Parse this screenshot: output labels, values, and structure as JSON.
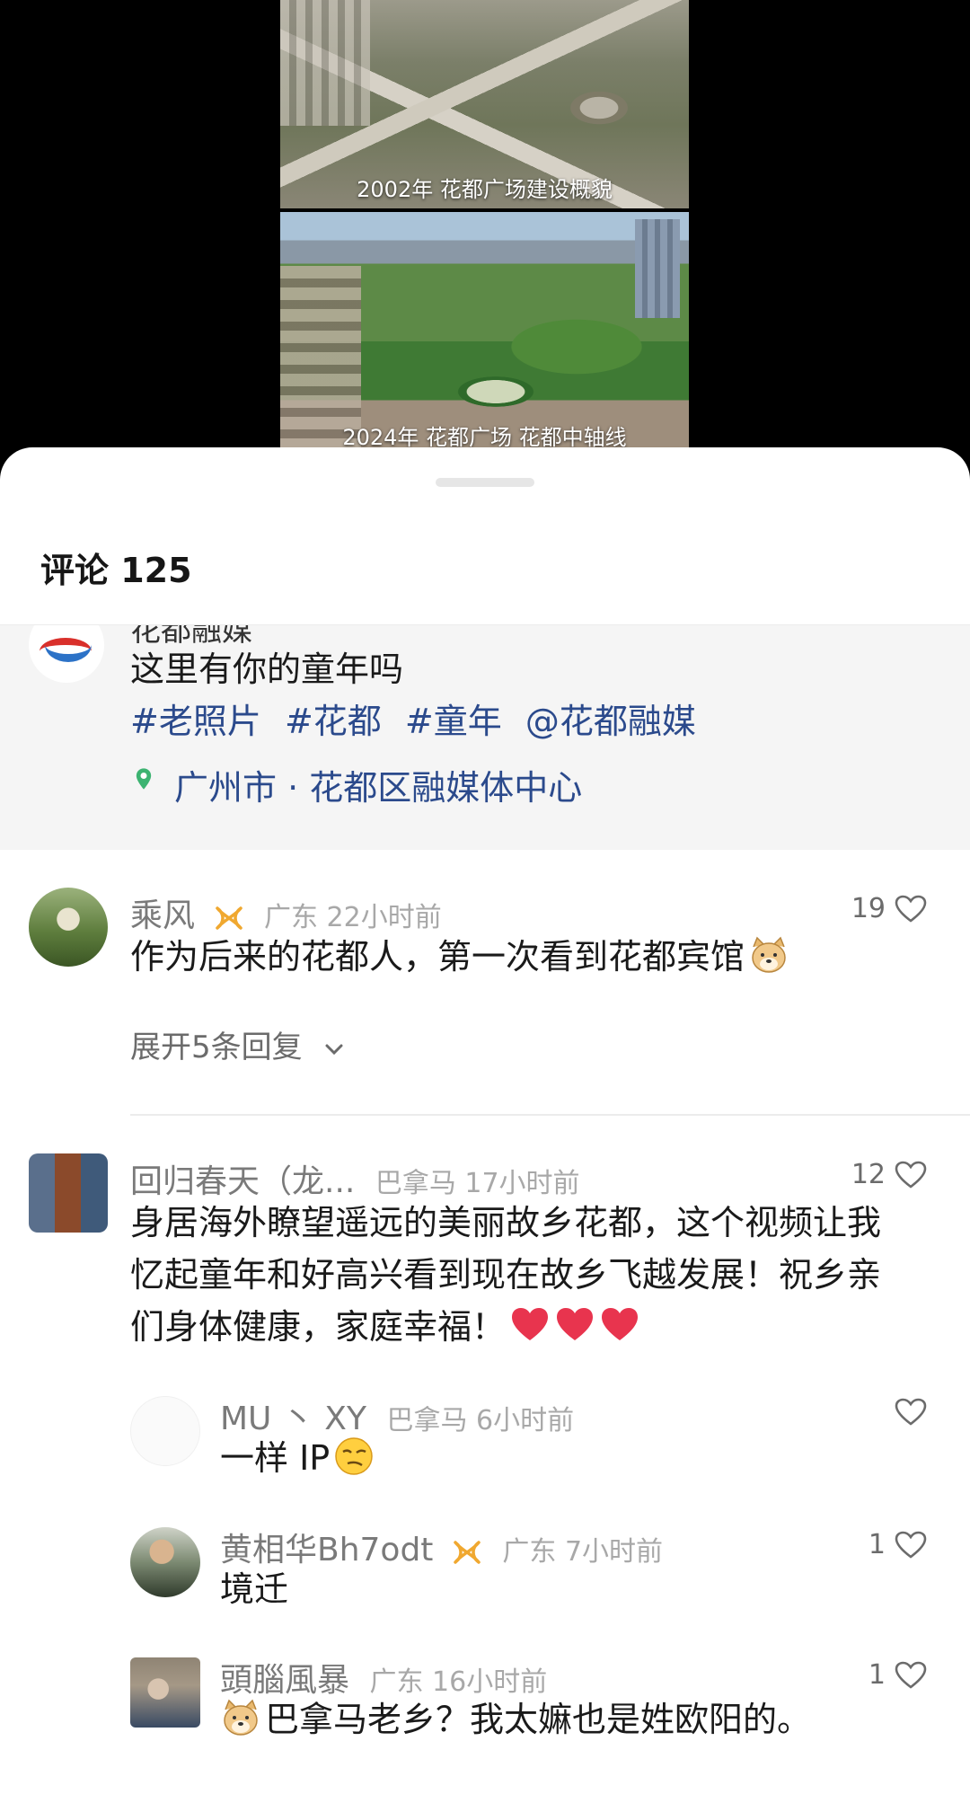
{
  "video": {
    "caption_top": "2002年 花都广场建设概貌",
    "caption_bottom": "2024年 花都广场 花都中轴线"
  },
  "sheet": {
    "title": "评论 125"
  },
  "post": {
    "author": "花都融媒",
    "text": "这里有你的童年吗",
    "tags": [
      "#老照片",
      "#花都",
      "#童年",
      "@花都融媒"
    ],
    "location": "广州市 · 花都区融媒体中心"
  },
  "comments": [
    {
      "name": "乘风",
      "region": "广东 22小时前",
      "likes": "19",
      "text": "作为后来的花都人，第一次看到花都宾馆",
      "expand": "展开5条回复"
    },
    {
      "name": "回归春天（龙...",
      "region": "巴拿马 17小时前",
      "likes": "12",
      "text": "身居海外瞭望遥远的美丽故乡花都，这个视频让我忆起童年和好高兴看到现在故乡飞越发展！祝乡亲们身体健康，家庭幸福！"
    }
  ],
  "replies": [
    {
      "name": "MU 丶 XY",
      "region": "巴拿马 6小时前",
      "likes": "",
      "text": "一样 IP"
    },
    {
      "name": "黄相华Bh7odt",
      "region": "广东 7小时前",
      "likes": "1",
      "text": "境迁"
    },
    {
      "name": "頭腦風暴",
      "region": "广东 16小时前",
      "likes": "1",
      "text": "巴拿马老乡？我太嫲也是姓欧阳的。"
    }
  ],
  "colors": {
    "link": "#2b4a8c",
    "location_pin": "#3cb371",
    "badge": "#f0a830",
    "heart_emoji": "#e8344e"
  }
}
